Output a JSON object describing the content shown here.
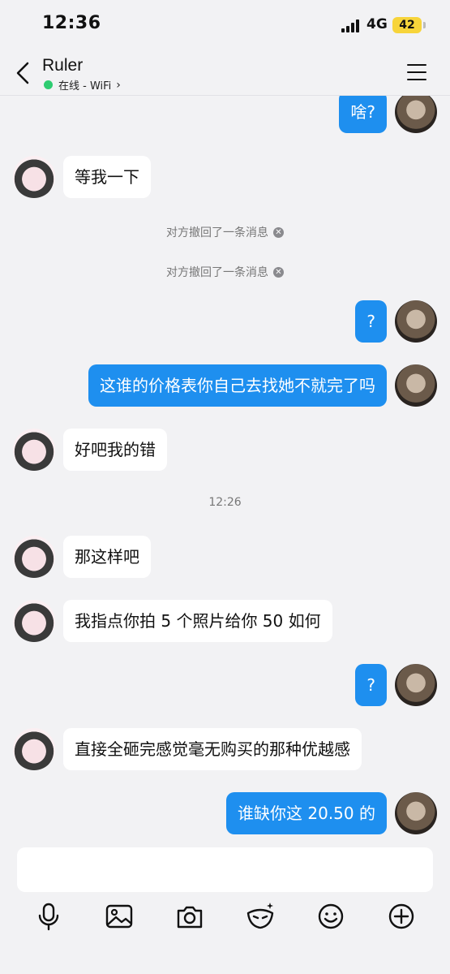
{
  "status_bar": {
    "time": "12:36",
    "network": "4G",
    "battery": "42"
  },
  "header": {
    "contact_name": "Ruler",
    "presence": "在线 - WiFi"
  },
  "messages": {
    "m1": "啥?",
    "m2": "等我一下",
    "recall1": "对方撤回了一条消息",
    "recall2": "对方撤回了一条消息",
    "m3": "?",
    "m4": "这谁的价格表你自己去找她不就完了吗",
    "m5": "好吧我的错",
    "timestamp": "12:26",
    "m6": "那这样吧",
    "m7": "我指点你拍 5 个照片给你 50 如何",
    "m8": "?",
    "m9": "直接全砸完感觉毫无购买的那种优越感",
    "m10": "谁缺你这 20.50 的"
  },
  "input": {
    "placeholder": ""
  },
  "toolbar": {
    "icons": [
      "microphone-icon",
      "image-icon",
      "camera-icon",
      "mask-effects-icon",
      "emoji-icon",
      "plus-icon"
    ]
  },
  "colors": {
    "outgoing_bubble": "#1e8fef",
    "incoming_bubble": "#ffffff",
    "background": "#f2f2f4",
    "online_dot": "#2ecc71",
    "battery": "#f7d43a"
  }
}
